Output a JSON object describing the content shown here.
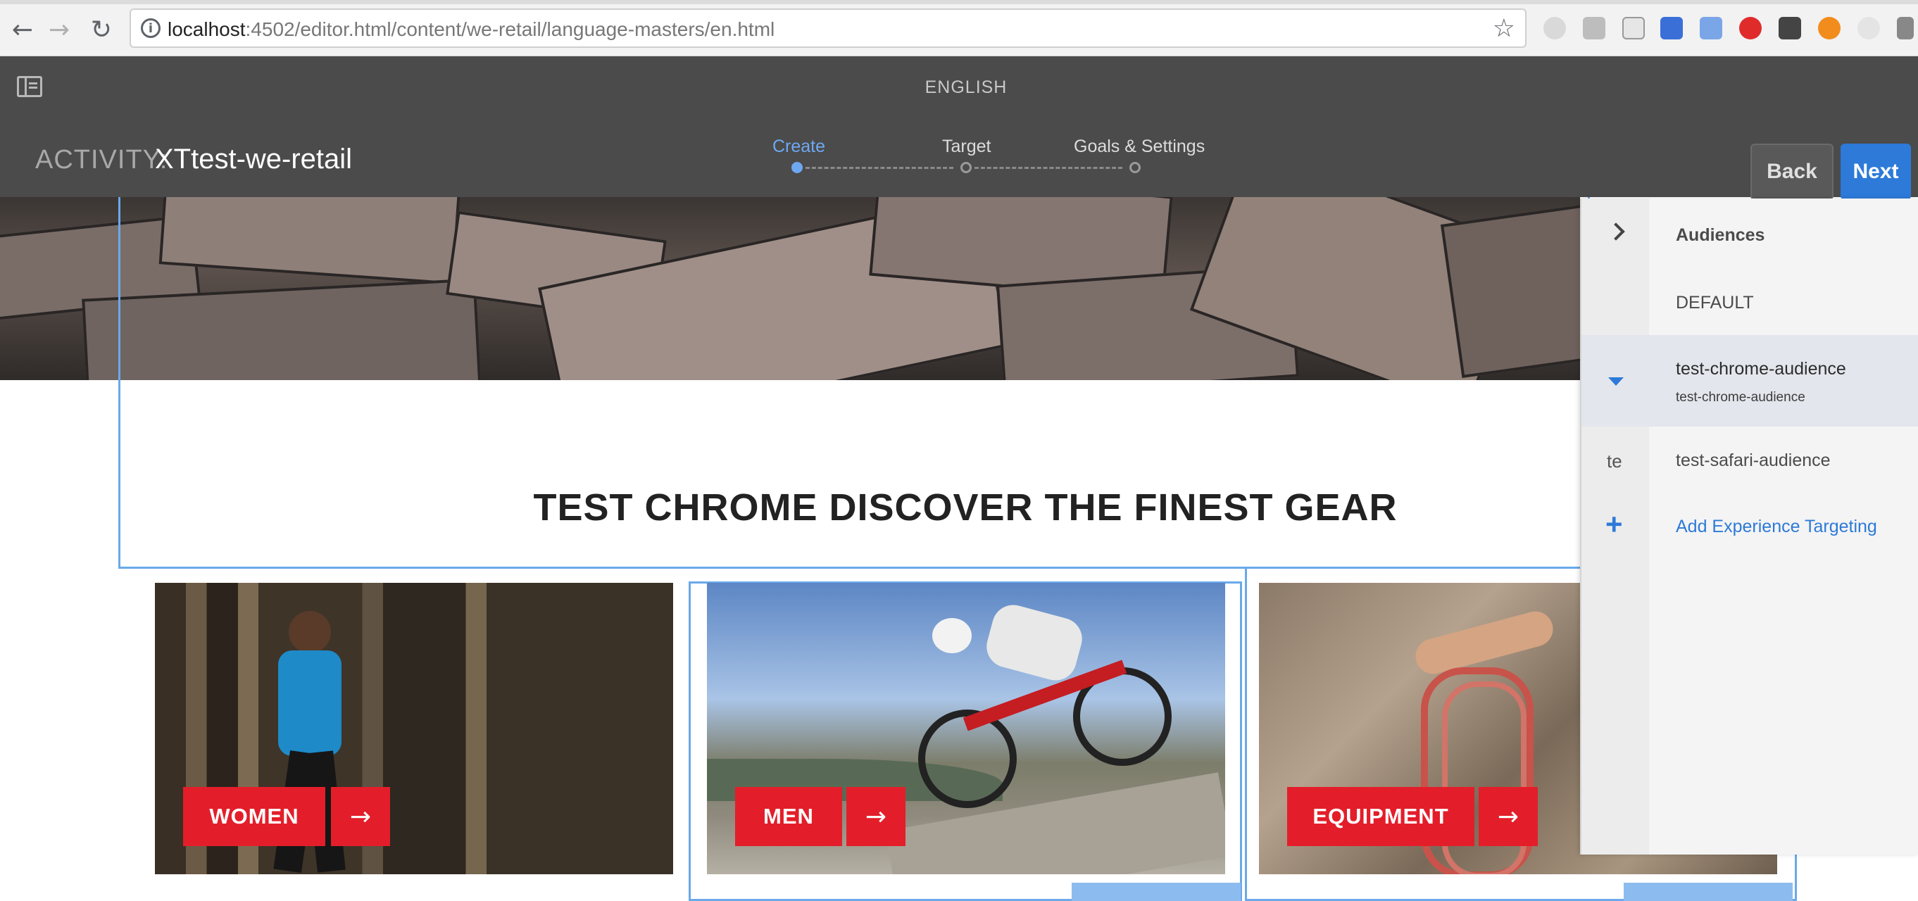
{
  "browser": {
    "url_host": "localhost",
    "url_rest": ":4502/editor.html/content/we-retail/language-masters/en.html",
    "icons": [
      "back-icon",
      "forward-icon",
      "reload-icon",
      "info-icon",
      "star-icon"
    ]
  },
  "header": {
    "language": "ENGLISH",
    "activity_prefix": "ACTIVITY:",
    "activity_name": "XTtest-we-retail",
    "steps": [
      "Create",
      "Target",
      "Goals & Settings"
    ],
    "active_step": "Create",
    "back_label": "Back",
    "next_label": "Next"
  },
  "page": {
    "headline": "TEST CHROME DISCOVER THE FINEST GEAR",
    "cards": [
      {
        "label": "WOMEN",
        "arrow": "→"
      },
      {
        "label": "MEN",
        "arrow": "→"
      },
      {
        "label": "EQUIPMENT",
        "arrow": "→"
      }
    ]
  },
  "audiences": {
    "title": "Audiences",
    "items": [
      {
        "label": "DEFAULT",
        "sub": "",
        "marker": ""
      },
      {
        "label": "test-chrome-audience",
        "sub": "test-chrome-audience",
        "marker": "caret-down-icon",
        "selected": true
      },
      {
        "label": "test-safari-audience",
        "sub": "",
        "marker": "te"
      }
    ],
    "add_label": "Add Experience Targeting",
    "add_marker": "+"
  },
  "colors": {
    "accent_blue": "#2d7ad8",
    "header_bg": "#4b4b4b",
    "cta_red": "#e31e2a",
    "selection_frame": "#6aa9ea"
  }
}
